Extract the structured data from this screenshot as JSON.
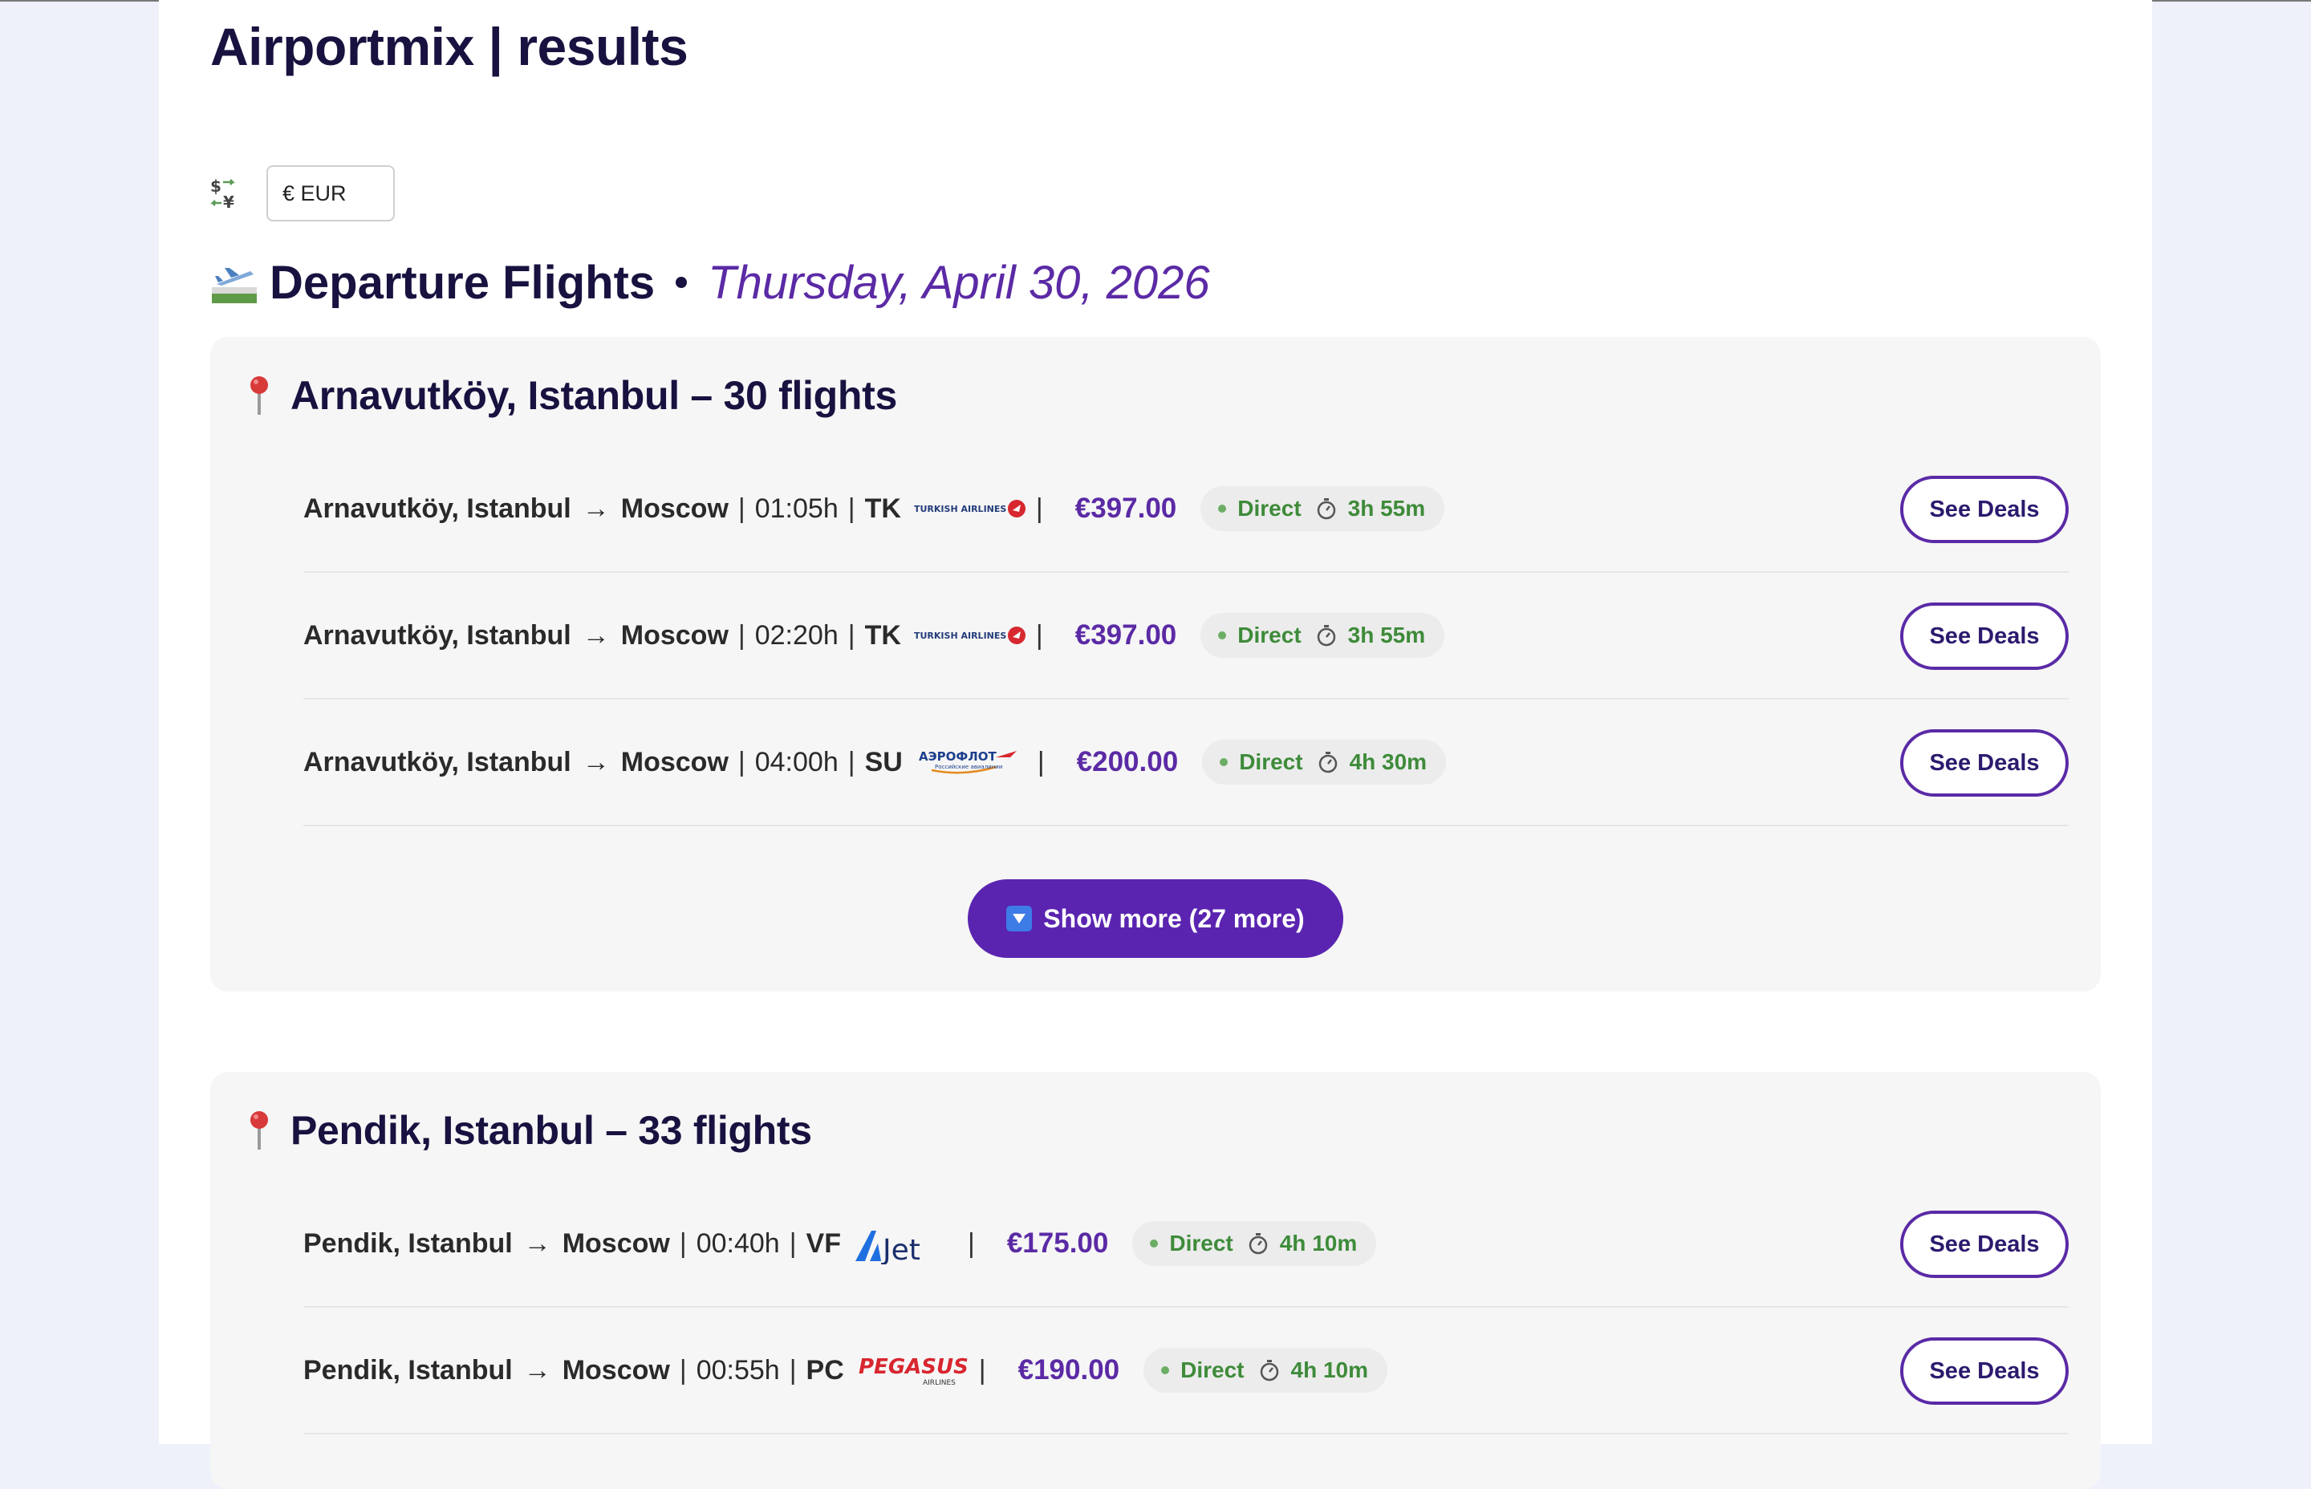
{
  "page": {
    "title": "Airportmix | results"
  },
  "currency": {
    "icon": "currency-exchange-icon",
    "selected": "€ EUR"
  },
  "departures": {
    "icon": "airplane-departure-icon",
    "title": "Departure Flights",
    "date": "Thursday, April 30, 2026"
  },
  "groups": [
    {
      "title": "Arnavutköy, Istanbul – 30 flights",
      "show_more_label": "Show more (27 more)",
      "flights": [
        {
          "origin": "Arnavutköy, Istanbul",
          "destination": "Moscow",
          "time": "01:05h",
          "carrier": "TK",
          "airline_logo": "TURKISH AIRLINES",
          "price": "€397.00",
          "type": "Direct",
          "duration": "3h 55m",
          "deals_label": "See Deals"
        },
        {
          "origin": "Arnavutköy, Istanbul",
          "destination": "Moscow",
          "time": "02:20h",
          "carrier": "TK",
          "airline_logo": "TURKISH AIRLINES",
          "price": "€397.00",
          "type": "Direct",
          "duration": "3h 55m",
          "deals_label": "See Deals"
        },
        {
          "origin": "Arnavutköy, Istanbul",
          "destination": "Moscow",
          "time": "04:00h",
          "carrier": "SU",
          "airline_logo": "АЭРОФЛОТ",
          "price": "€200.00",
          "type": "Direct",
          "duration": "4h 30m",
          "deals_label": "See Deals"
        }
      ]
    },
    {
      "title": "Pendik, Istanbul – 33 flights",
      "flights": [
        {
          "origin": "Pendik, Istanbul",
          "destination": "Moscow",
          "time": "00:40h",
          "carrier": "VF",
          "airline_logo": "AJet",
          "price": "€175.00",
          "type": "Direct",
          "duration": "4h 10m",
          "deals_label": "See Deals"
        },
        {
          "origin": "Pendik, Istanbul",
          "destination": "Moscow",
          "time": "00:55h",
          "carrier": "PC",
          "airline_logo": "PEGASUS",
          "price": "€190.00",
          "type": "Direct",
          "duration": "4h 10m",
          "deals_label": "See Deals"
        }
      ]
    }
  ],
  "colors": {
    "accent": "#5a24b0",
    "price": "#5b2aa5",
    "direct": "#3e8b3a",
    "heading": "#17123f"
  }
}
